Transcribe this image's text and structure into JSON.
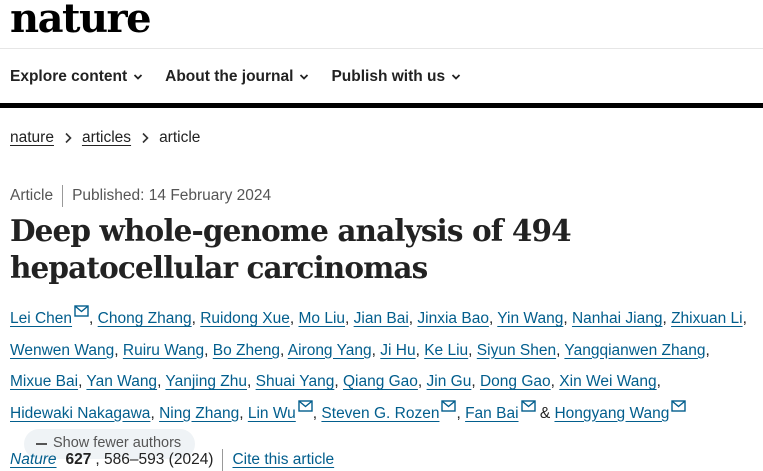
{
  "brand": {
    "logo": "nature"
  },
  "nav": {
    "items": [
      {
        "label": "Explore content"
      },
      {
        "label": "About the journal"
      },
      {
        "label": "Publish with us"
      }
    ]
  },
  "breadcrumb": {
    "items": [
      "nature",
      "articles"
    ],
    "current": "article"
  },
  "article": {
    "type": "Article",
    "published": "Published: 14 February 2024",
    "title": "Deep whole-genome analysis of 494 hepatocellular carcinomas"
  },
  "authors": {
    "list": [
      {
        "name": "Lei Chen",
        "email": true
      },
      {
        "name": "Chong Zhang"
      },
      {
        "name": "Ruidong Xue"
      },
      {
        "name": "Mo Liu"
      },
      {
        "name": "Jian Bai"
      },
      {
        "name": "Jinxia Bao"
      },
      {
        "name": "Yin Wang"
      },
      {
        "name": "Nanhai Jiang"
      },
      {
        "name": "Zhixuan Li"
      },
      {
        "name": "Wenwen Wang"
      },
      {
        "name": "Ruiru Wang"
      },
      {
        "name": "Bo Zheng"
      },
      {
        "name": "Airong Yang"
      },
      {
        "name": "Ji Hu"
      },
      {
        "name": "Ke Liu"
      },
      {
        "name": "Siyun Shen"
      },
      {
        "name": "Yangqianwen Zhang"
      },
      {
        "name": "Mixue Bai"
      },
      {
        "name": "Yan Wang"
      },
      {
        "name": "Yanjing Zhu"
      },
      {
        "name": "Shuai Yang"
      },
      {
        "name": "Qiang Gao"
      },
      {
        "name": "Jin Gu"
      },
      {
        "name": "Dong Gao"
      },
      {
        "name": "Xin Wei Wang"
      },
      {
        "name": "Hidewaki Nakagawa"
      },
      {
        "name": "Ning Zhang"
      },
      {
        "name": "Lin Wu",
        "email": true
      },
      {
        "name": "Steven G. Rozen",
        "email": true
      },
      {
        "name": "Fan Bai",
        "email": true
      },
      {
        "name": "Hongyang Wang",
        "email": true
      }
    ],
    "show_fewer_label": "Show fewer authors"
  },
  "citation": {
    "journal": "Nature",
    "volume": "627",
    "pages": ", 586–593 (2024)",
    "cite_label": "Cite this article"
  },
  "colors": {
    "link": "#025e8d",
    "text": "#222222",
    "muted": "#555555",
    "pill_bg": "#eff3f6"
  }
}
